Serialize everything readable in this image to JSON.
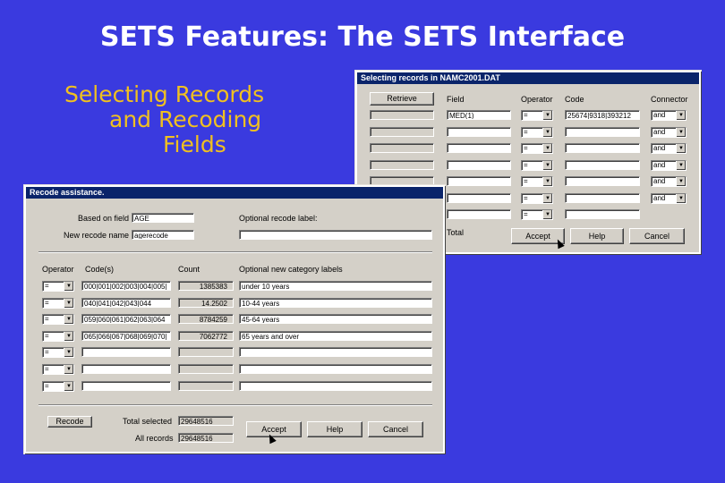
{
  "slide": {
    "title": "SETS Features: The SETS Interface",
    "subtitle_lines": [
      "Selecting Records",
      "and Recoding",
      "Fields"
    ]
  },
  "selecting": {
    "title": "Selecting records in NAMC2001.DAT",
    "retrieve_label": "Retrieve",
    "headers": {
      "field": "Field",
      "operator": "Operator",
      "code": "Code",
      "connector": "Connector"
    },
    "rows": [
      {
        "field": "MED(1)",
        "operator": "=",
        "code": "25674|9318|393212",
        "connector": "and"
      },
      {
        "field": "",
        "operator": "=",
        "code": "",
        "connector": "and"
      },
      {
        "field": "",
        "operator": "=",
        "code": "",
        "connector": "and"
      },
      {
        "field": "",
        "operator": "=",
        "code": "",
        "connector": "and"
      },
      {
        "field": "",
        "operator": "=",
        "code": "",
        "connector": "and"
      },
      {
        "field": "",
        "operator": "=",
        "code": "",
        "connector": "and"
      },
      {
        "field": "",
        "operator": "=",
        "code": "",
        "connector": ""
      }
    ],
    "total_label": "Total",
    "accept_label": "Accept",
    "help_label": "Help",
    "cancel_label": "Cancel"
  },
  "recode": {
    "title": "Recode assistance.",
    "based_on_label": "Based on field",
    "based_on_value": "AGE",
    "new_name_label": "New recode name",
    "new_name_value": "agerecode",
    "optional_label": "Optional recode label:",
    "headers": {
      "operator": "Operator",
      "codes": "Code(s)",
      "count": "Count",
      "optional": "Optional new category labels"
    },
    "rows": [
      {
        "operator": "=",
        "codes": "000|001|002|003|004|005|",
        "count": "1385383",
        "label": "under 10 years"
      },
      {
        "operator": "=",
        "codes": "040|041|042|043|044",
        "count": "14.2502",
        "label": "10-44 years"
      },
      {
        "operator": "=",
        "codes": "059|060|061|062|063|064",
        "count": "8784259",
        "label": "45-64 years"
      },
      {
        "operator": "=",
        "codes": "065|066|067|068|069|070|",
        "count": "7062772",
        "label": "65 years and over"
      },
      {
        "operator": "=",
        "codes": "",
        "count": "",
        "label": ""
      },
      {
        "operator": "=",
        "codes": "",
        "count": "",
        "label": ""
      },
      {
        "operator": "=",
        "codes": "",
        "count": "",
        "label": ""
      }
    ],
    "recode_btn": "Recode",
    "total_selected_label": "Total selected",
    "total_selected_value": "29648516",
    "all_records_label": "All records",
    "all_records_value": "29648516",
    "accept_label": "Accept",
    "help_label": "Help",
    "cancel_label": "Cancel"
  }
}
